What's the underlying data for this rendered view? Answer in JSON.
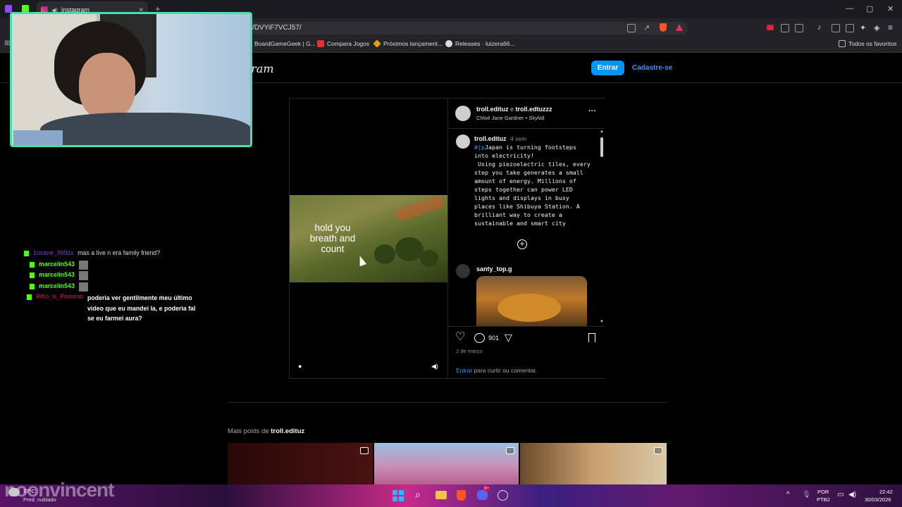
{
  "browser": {
    "active_tab_title": "Instagram",
    "url": "/DVYiF7VCJ57/",
    "bookmarks": [
      {
        "label": "BoardGameGeek | G...",
        "color": "#3f3a60"
      },
      {
        "label": "Compara Jogos",
        "color": "#d33"
      },
      {
        "label": "Próximos lançament...",
        "color": "#e0a010"
      },
      {
        "label": "Releases · luizera66...",
        "color": "#ddd"
      }
    ],
    "other_favorites": "Todos os favoritos"
  },
  "instagram": {
    "logo_fragment": "gram",
    "login_button": "Entrar",
    "signup_button": "Cadastre-se",
    "post": {
      "author": "troll.edituz",
      "collab_joiner": " e ",
      "collaborator": "troll.edtuzzz",
      "audio": "Chloé Jane Gardner • Skyfall",
      "video_text": "hold you breath and count",
      "caption_author": "troll.edituz",
      "caption_age": "4 sem",
      "caption_hashtag": "#jp",
      "caption_text": "Japan is turning footsteps into electricity!\n Using piezoelectric tiles, every step you take generates a small amount of energy. Millions of steps together can power LED lights and displays in busy places like Shibuya Station. A brilliant way to create a sustainable and smart city",
      "comment_author": "santy_top.g",
      "comment_count": "901",
      "date": "2 de março",
      "login_prompt_link": "Entrar",
      "login_prompt_text": " para curtir ou comentar."
    },
    "more_posts_label": "Mais posts de ",
    "more_posts_user": "troll.edituz"
  },
  "chat": [
    {
      "user": "1nsane_999zx",
      "message": "mas a live n era family friend?",
      "user_color": "#7a3fc8"
    },
    {
      "user": "marcelin543",
      "message": "",
      "user_color": "#53fc18"
    },
    {
      "user": "marcelin543",
      "message": "",
      "user_color": "#53fc18"
    },
    {
      "user": "marcelin543",
      "message": "",
      "user_color": "#53fc18"
    },
    {
      "user": "Who_is_Pedroso",
      "message": "poderia ver gentilmente meu último video que eu mandei la, e poderia fal se eu farmei aura?",
      "user_color": "#d21f4a"
    }
  ],
  "overlay_name": "noonvincent",
  "taskbar": {
    "weather_temp": "27°C",
    "weather_desc": "Pred. nublado",
    "lang_top": "POR",
    "lang_bottom": "PTB2",
    "time": "22:42",
    "date": "30/03/2026",
    "discord_badge": "9+"
  },
  "colors": {
    "accent": "#0095f6",
    "link": "#4a8df8",
    "webcam_border": "#45e0b0"
  }
}
